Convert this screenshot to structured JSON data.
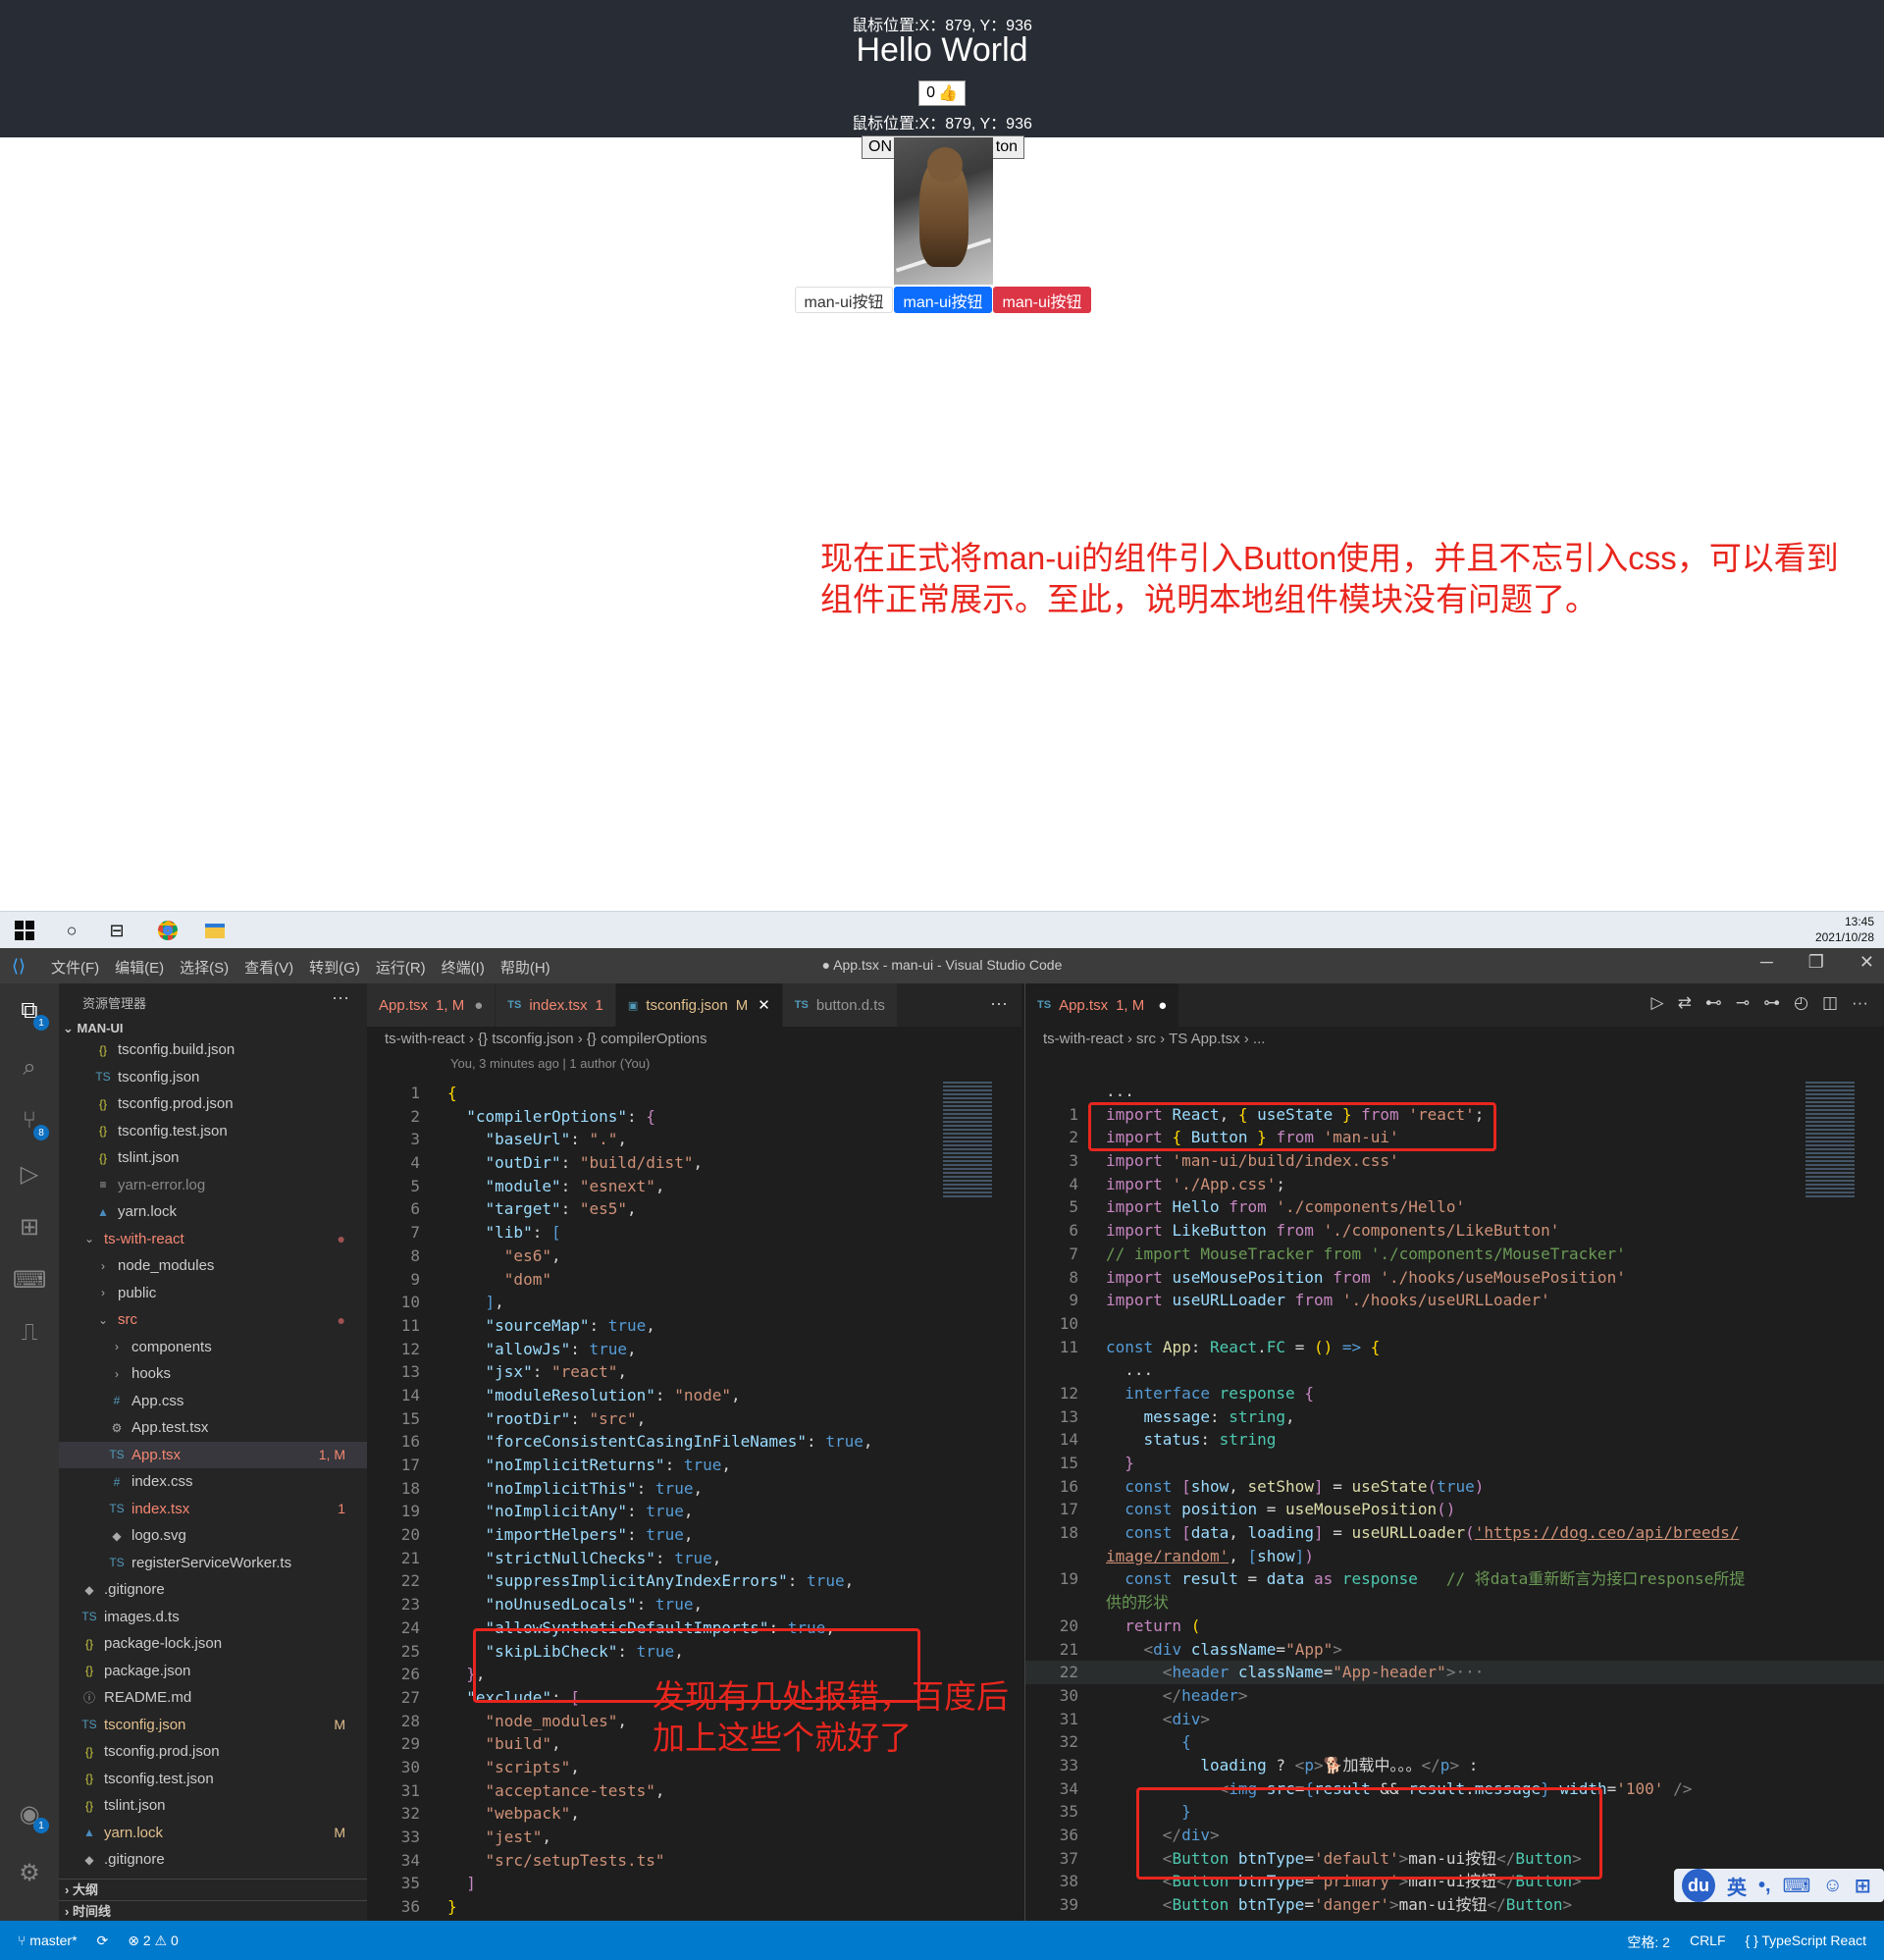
{
  "app": {
    "mouse_text_top": "鼠标位置:X：879, Y：936",
    "hello": "Hello World",
    "like_count": "0",
    "like_icon": "thumbs-up-icon",
    "mouse_text_bottom": "鼠标位置:X：879, Y：936",
    "toggle_left": "ON",
    "toggle_right": "ton",
    "buttons": {
      "default": "man-ui按钮",
      "primary": "man-ui按钮",
      "danger": "man-ui按钮"
    },
    "annotation": "现在正式将man-ui的组件引入Button使用，并且不忘引入css，可以看到组件正常展示。至此，说明本地组件模块没有问题了。"
  },
  "taskbar": {
    "time": "13:45",
    "date": "2021/10/28"
  },
  "vscode": {
    "menu": [
      "文件(F)",
      "编辑(E)",
      "选择(S)",
      "查看(V)",
      "转到(G)",
      "运行(R)",
      "终端(I)",
      "帮助(H)"
    ],
    "window_title": "● App.tsx - man-ui - Visual Studio Code",
    "sidebar": {
      "header": "资源管理器",
      "more": "···",
      "root": "MAN-UI",
      "items": [
        {
          "label": "tsconfig.build.json",
          "icon": "{}",
          "status": ""
        },
        {
          "label": "tsconfig.json",
          "icon": "TS",
          "status": ""
        },
        {
          "label": "tsconfig.prod.json",
          "icon": "{}",
          "status": ""
        },
        {
          "label": "tsconfig.test.json",
          "icon": "{}",
          "status": ""
        },
        {
          "label": "tslint.json",
          "icon": "{}",
          "status": ""
        },
        {
          "label": "yarn-error.log",
          "icon": "≡",
          "status": ""
        },
        {
          "label": "yarn.lock",
          "icon": "▲",
          "status": ""
        },
        {
          "label": "ts-with-react",
          "icon": "⌄",
          "status": "●"
        },
        {
          "label": "node_modules",
          "icon": "›",
          "status": ""
        },
        {
          "label": "public",
          "icon": "›",
          "status": ""
        },
        {
          "label": "src",
          "icon": "⌄",
          "status": "●"
        },
        {
          "label": "components",
          "icon": "›",
          "status": ""
        },
        {
          "label": "hooks",
          "icon": "›",
          "status": ""
        },
        {
          "label": "App.css",
          "icon": "#",
          "status": ""
        },
        {
          "label": "App.test.tsx",
          "icon": "⚙",
          "status": ""
        },
        {
          "label": "App.tsx",
          "icon": "TS",
          "status": "1, M"
        },
        {
          "label": "index.css",
          "icon": "#",
          "status": ""
        },
        {
          "label": "index.tsx",
          "icon": "TS",
          "status": "1"
        },
        {
          "label": "logo.svg",
          "icon": "◆",
          "status": ""
        },
        {
          "label": "registerServiceWorker.ts",
          "icon": "TS",
          "status": ""
        },
        {
          "label": ".gitignore",
          "icon": "◆",
          "status": ""
        },
        {
          "label": "images.d.ts",
          "icon": "TS",
          "status": ""
        },
        {
          "label": "package-lock.json",
          "icon": "{}",
          "status": ""
        },
        {
          "label": "package.json",
          "icon": "{}",
          "status": ""
        },
        {
          "label": "README.md",
          "icon": "ⓘ",
          "status": ""
        },
        {
          "label": "tsconfig.json",
          "icon": "TS",
          "status": "M"
        },
        {
          "label": "tsconfig.prod.json",
          "icon": "{}",
          "status": ""
        },
        {
          "label": "tsconfig.test.json",
          "icon": "{}",
          "status": ""
        },
        {
          "label": "tslint.json",
          "icon": "{}",
          "status": ""
        },
        {
          "label": "yarn.lock",
          "icon": "▲",
          "status": "M"
        },
        {
          "label": ".gitignore",
          "icon": "◆",
          "status": ""
        }
      ],
      "outline": "大纲",
      "timeline": "时间线"
    },
    "left_tabs": [
      {
        "label": "App.tsx",
        "badge": "1, M",
        "mark": "●"
      },
      {
        "label": "index.tsx",
        "badge": "1",
        "mark": ""
      },
      {
        "label": "tsconfig.json",
        "badge": "M",
        "mark": "✕"
      },
      {
        "label": "button.d.ts",
        "badge": "",
        "mark": ""
      }
    ],
    "left_crumbs": "ts-with-react › {} tsconfig.json › {} compilerOptions",
    "left_blame": "You, 3 minutes ago | 1 author (You)",
    "right_tab": {
      "label": "App.tsx",
      "badge": "1, M",
      "mark": "●"
    },
    "right_crumbs": "ts-with-react › src › TS App.tsx › ...",
    "left_annotation_line1": "发现有几处报错，百度后",
    "left_annotation_line2": "加上这些个就好了",
    "status": {
      "branch": "master*",
      "sync": "⟳",
      "problems": "⊗ 2 ⚠ 0",
      "spaces": "空格: 2",
      "eol": "CRLF",
      "lang": "{ } TypeScript React"
    },
    "ime": {
      "logo": "du",
      "mode": "英"
    }
  }
}
